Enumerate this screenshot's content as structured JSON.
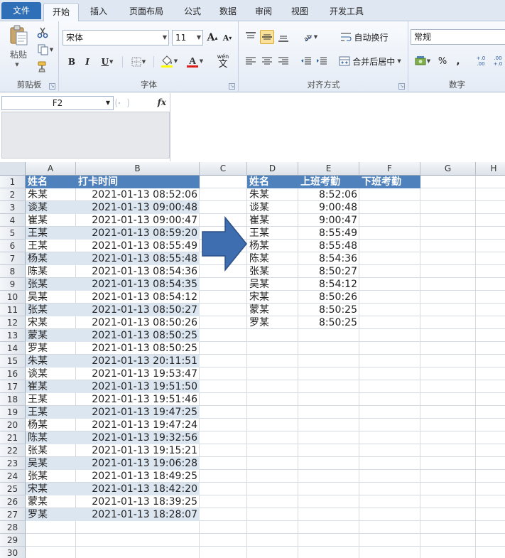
{
  "tabs": [
    "文件",
    "开始",
    "插入",
    "页面布局",
    "公式",
    "数据",
    "审阅",
    "视图",
    "开发工具"
  ],
  "ribbon": {
    "clipboard": {
      "paste_label": "粘贴",
      "group_label": "剪贴板"
    },
    "font": {
      "font_name": "宋体",
      "font_size": "11",
      "group_label": "字体",
      "grow_label": "A",
      "shrink_label": "A",
      "bold": "B",
      "italic": "I",
      "underline": "U",
      "phonetic": "wén",
      "phonetic_char": "文"
    },
    "alignment": {
      "wrap_label": "自动换行",
      "merge_label": "合并后居中",
      "group_label": "对齐方式"
    },
    "number": {
      "format": "常规",
      "group_label": "数字",
      "percent": "%",
      "comma": ",",
      "inc_dec": "+.0 .00",
      "dec_dec": ".00 +.0"
    }
  },
  "name_box": "F2",
  "fx_label": "fx",
  "columns": [
    "A",
    "B",
    "C",
    "D",
    "E",
    "F",
    "G",
    "H"
  ],
  "rows": [
    "1",
    "2",
    "3",
    "4",
    "5",
    "6",
    "7",
    "8",
    "9",
    "10",
    "11",
    "12",
    "13",
    "14",
    "15",
    "16",
    "17",
    "18",
    "19",
    "20",
    "21",
    "22",
    "23",
    "24",
    "25",
    "26",
    "27",
    "28",
    "29",
    "30"
  ],
  "left_table": {
    "headers": [
      "姓名",
      "打卡时间"
    ],
    "rows": [
      [
        "朱某",
        "2021-01-13 08:52:06"
      ],
      [
        "谈某",
        "2021-01-13 09:00:48"
      ],
      [
        "崔某",
        "2021-01-13 09:00:47"
      ],
      [
        "王某",
        "2021-01-13 08:59:20"
      ],
      [
        "王某",
        "2021-01-13 08:55:49"
      ],
      [
        "杨某",
        "2021-01-13 08:55:48"
      ],
      [
        "陈某",
        "2021-01-13 08:54:36"
      ],
      [
        "张某",
        "2021-01-13 08:54:35"
      ],
      [
        "吴某",
        "2021-01-13 08:54:12"
      ],
      [
        "张某",
        "2021-01-13 08:50:27"
      ],
      [
        "宋某",
        "2021-01-13 08:50:26"
      ],
      [
        "蒙某",
        "2021-01-13 08:50:25"
      ],
      [
        "罗某",
        "2021-01-13 08:50:25"
      ],
      [
        "朱某",
        "2021-01-13 20:11:51"
      ],
      [
        "谈某",
        "2021-01-13 19:53:47"
      ],
      [
        "崔某",
        "2021-01-13 19:51:50"
      ],
      [
        "王某",
        "2021-01-13 19:51:46"
      ],
      [
        "王某",
        "2021-01-13 19:47:25"
      ],
      [
        "杨某",
        "2021-01-13 19:47:24"
      ],
      [
        "陈某",
        "2021-01-13 19:32:56"
      ],
      [
        "张某",
        "2021-01-13 19:15:21"
      ],
      [
        "吴某",
        "2021-01-13 19:06:28"
      ],
      [
        "张某",
        "2021-01-13 18:49:25"
      ],
      [
        "宋某",
        "2021-01-13 18:42:20"
      ],
      [
        "蒙某",
        "2021-01-13 18:39:25"
      ],
      [
        "罗某",
        "2021-01-13 18:28:07"
      ]
    ]
  },
  "right_table": {
    "headers": [
      "姓名",
      "上班考勤",
      "下班考勤"
    ],
    "rows": [
      [
        "朱某",
        "8:52:06"
      ],
      [
        "谈某",
        "9:00:48"
      ],
      [
        "崔某",
        "9:00:47"
      ],
      [
        "王某",
        "8:55:49"
      ],
      [
        "杨某",
        "8:55:48"
      ],
      [
        "陈某",
        "8:54:36"
      ],
      [
        "张某",
        "8:50:27"
      ],
      [
        "吴某",
        "8:54:12"
      ],
      [
        "宋某",
        "8:50:26"
      ],
      [
        "蒙某",
        "8:50:25"
      ],
      [
        "罗某",
        "8:50:25"
      ]
    ]
  },
  "colors": {
    "header_fill": "#4f81bd",
    "band_fill": "#dce6f1",
    "arrow_fill": "#3f6eb0",
    "file_tab": "#2f6fb8"
  }
}
